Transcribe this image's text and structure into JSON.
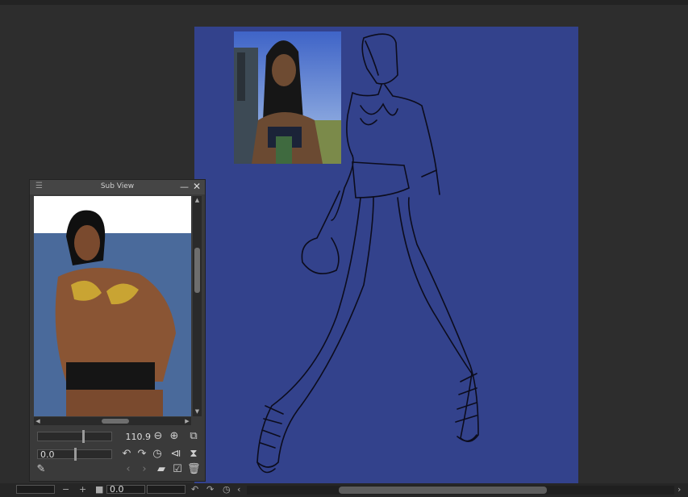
{
  "subview": {
    "title": "Sub View",
    "menu_icon": "hamburger-icon",
    "zoom_value": "110.9",
    "zoom_level": 110.9,
    "rotation_value": "0.0",
    "icons": [
      "zoom-out-icon",
      "zoom-in-icon",
      "fit-window-icon",
      "rotate-left-icon",
      "rotate-right-icon",
      "reset-rotation-icon",
      "flip-horizontal-icon",
      "flip-vertical-icon",
      "eyedropper-icon",
      "previous-image-icon",
      "next-image-icon",
      "import-image-icon",
      "edit-image-icon",
      "delete-image-icon"
    ]
  },
  "bottombar": {
    "rotation_value": "0.0",
    "icons": [
      "zoom-out-icon",
      "zoom-in-icon",
      "fit-icon",
      "rotate-left-icon",
      "rotate-right-icon",
      "reset-rotation-icon",
      "scroll-left-icon",
      "scroll-right-icon"
    ]
  },
  "colors": {
    "canvas": "#33428c",
    "workspace": "#2d2d2d",
    "panel": "#3a3a3a"
  }
}
